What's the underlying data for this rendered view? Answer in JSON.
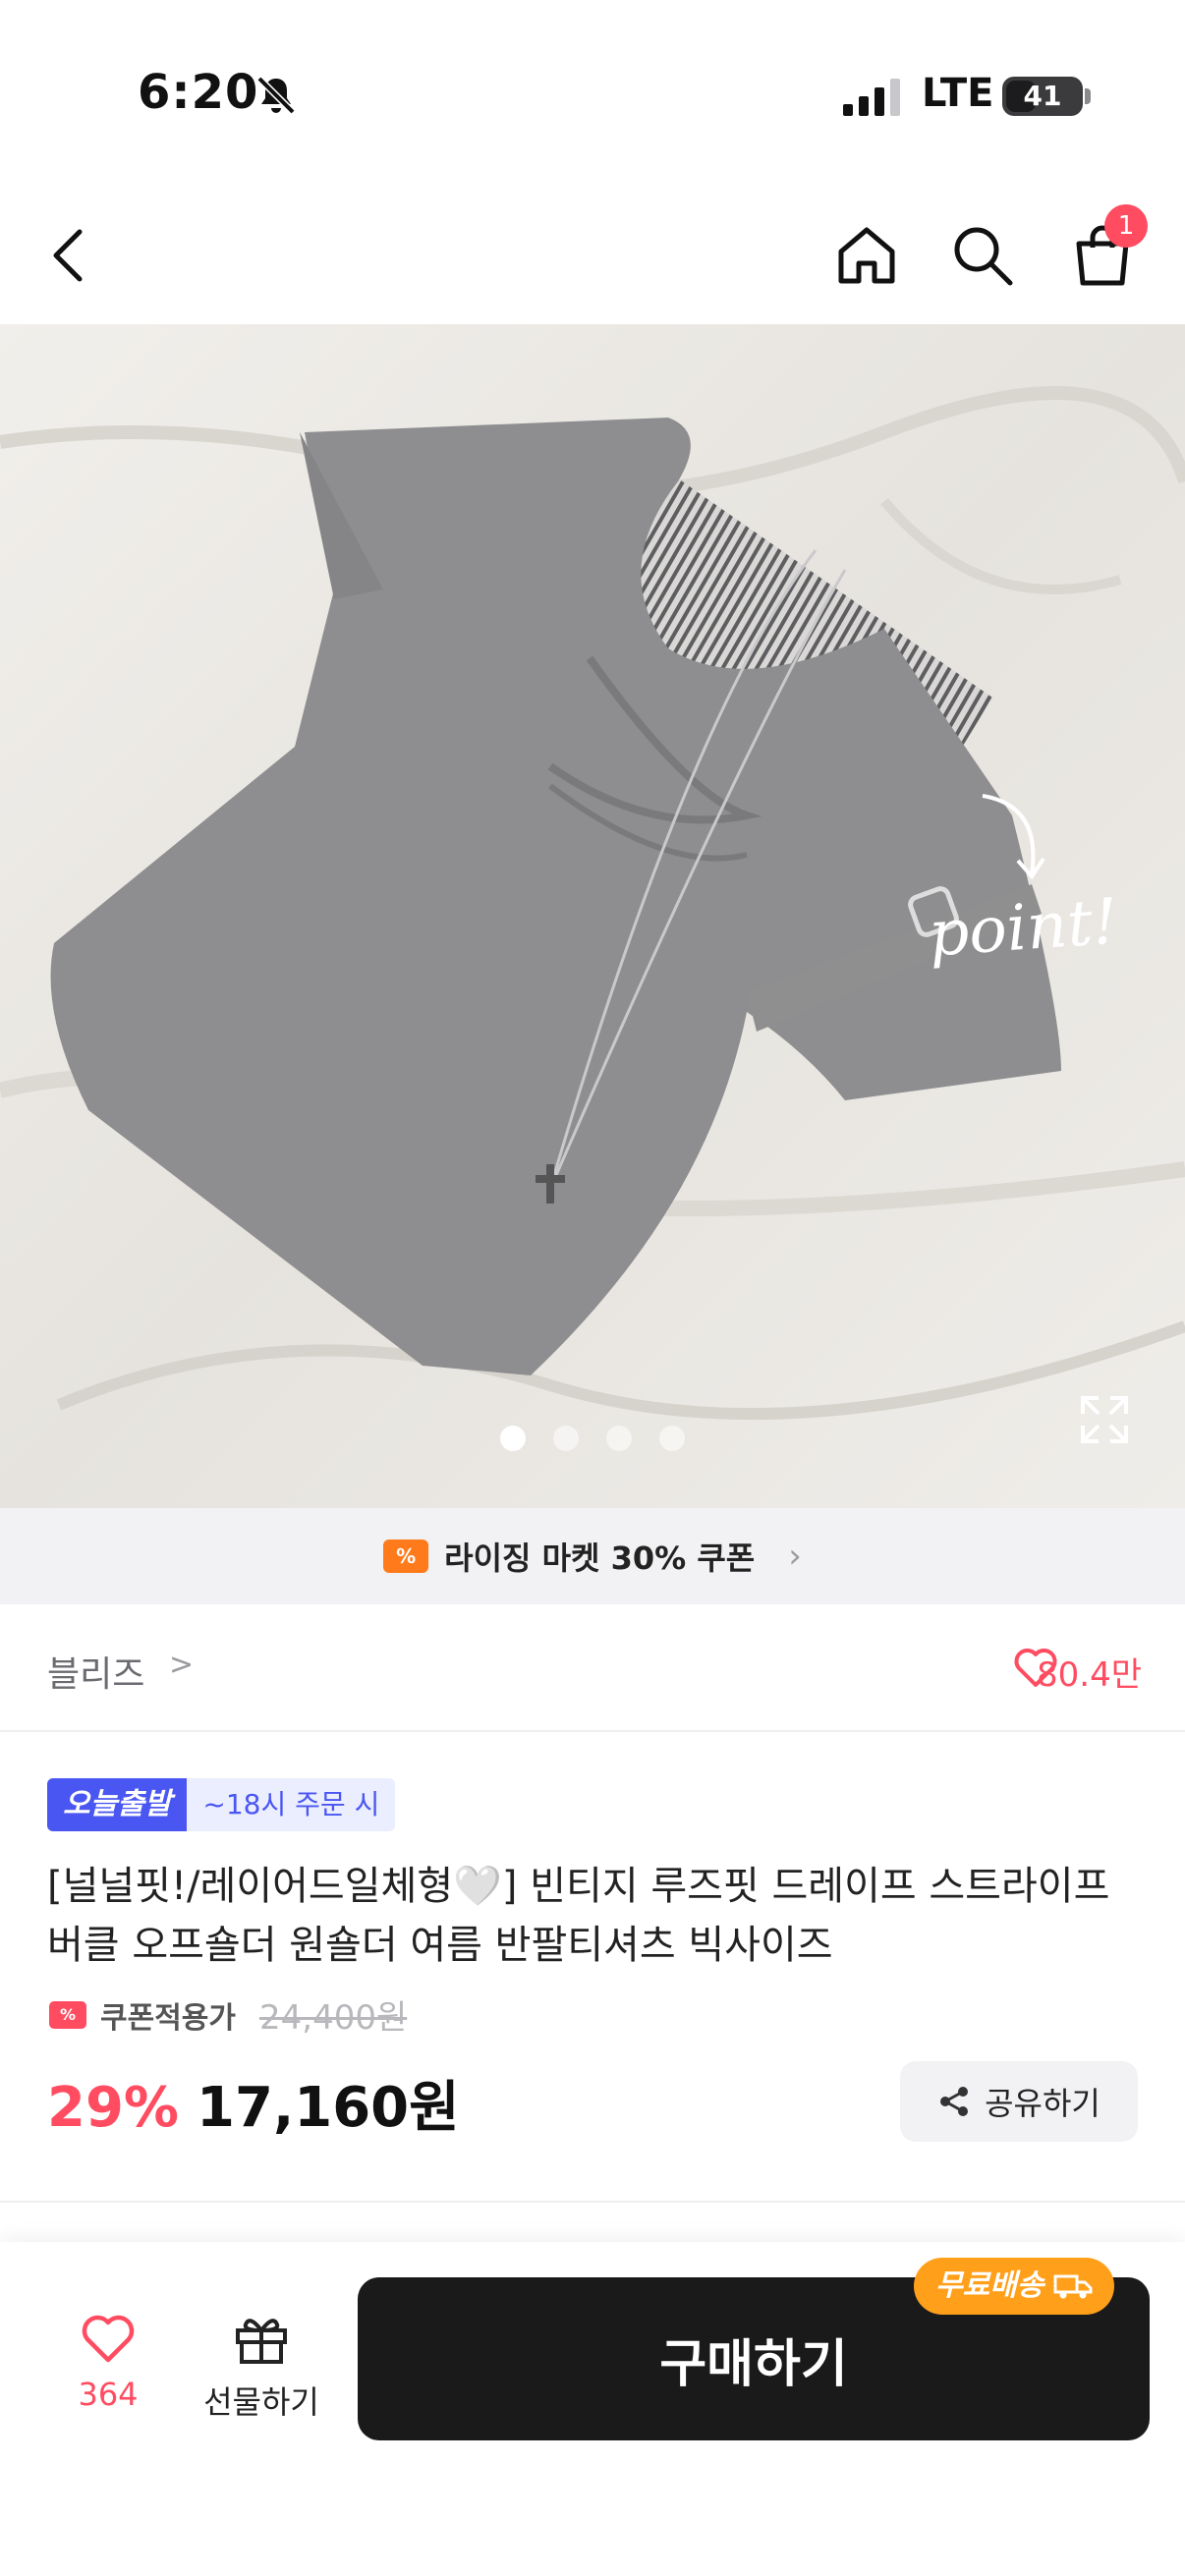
{
  "status_bar": {
    "time": "6:20",
    "network": "LTE",
    "battery": "41",
    "battery_level": 0.41
  },
  "nav": {
    "cart_count": "1",
    "icons": [
      "back-icon",
      "home-icon",
      "search-icon",
      "cart-icon"
    ]
  },
  "hero": {
    "annotation": "point!",
    "image_count": 4,
    "active_index": 0
  },
  "coupon_banner": {
    "label": "라이징 마켓 30% 쿠폰",
    "icon_text": "%"
  },
  "brand": {
    "name": "블리즈",
    "chevron": ">",
    "likes": "80.4만"
  },
  "product": {
    "badge_today": "오늘출발",
    "badge_time": "~18시 주문 시",
    "title": "[널널핏!/레이어드일체형🤍] 빈티지 루즈핏 드레이프 스트라이프 버클 오프숄더 원숄더 여름 반팔티셔츠 빅사이즈",
    "coupon_label": "쿠폰적용가",
    "original_price": "24,400원",
    "discount": "29%",
    "price": "17,160원",
    "share_label": "공유하기"
  },
  "bottom_bar": {
    "like_count": "364",
    "gift_label": "선물하기",
    "buy_label": "구매하기",
    "free_shipping": "무료배송"
  },
  "colors": {
    "accent": "#ff4c61",
    "brand_blue": "#4a56f2",
    "orange": "#ff9f1a",
    "dark": "#1a1a1a"
  }
}
